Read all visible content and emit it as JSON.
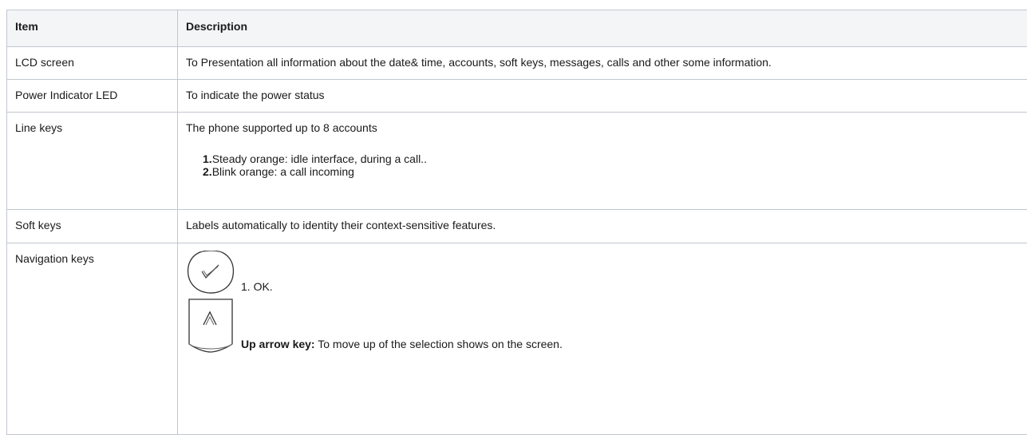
{
  "table": {
    "headers": {
      "item": "Item",
      "description": "Description"
    },
    "rows": {
      "lcd": {
        "item": "LCD screen",
        "description": "To Presentation all information about the date& time, accounts, soft keys, messages, calls and other some information."
      },
      "power": {
        "item": "Power Indicator LED",
        "description": "To indicate the power status"
      },
      "line": {
        "item": "Line keys",
        "description": "The phone supported up to 8 accounts",
        "list": [
          {
            "num": "1.",
            "text": "Steady orange: idle interface, during a call.."
          },
          {
            "num": "2.",
            "text": "Blink orange: a call incoming"
          }
        ]
      },
      "soft": {
        "item": "Soft keys",
        "description": "Labels automatically to identity their context-sensitive features."
      },
      "navigation": {
        "item": "Navigation keys",
        "ok_text": "1. OK.",
        "up_key_label": "Up arrow key:",
        "up_key_text": " To move up of the selection shows on the screen.",
        "icons": [
          "ok-key-icon",
          "up-arrow-key-icon"
        ]
      }
    }
  }
}
